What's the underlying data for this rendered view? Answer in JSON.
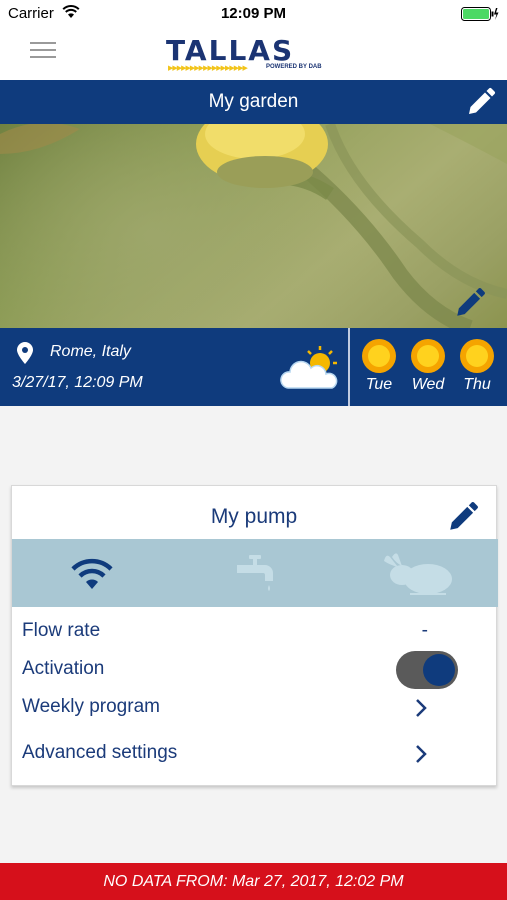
{
  "status_bar": {
    "carrier": "Carrier",
    "time": "12:09 PM"
  },
  "header": {
    "logo_text": "TALLAS",
    "logo_tagline": "POWERED BY DAB"
  },
  "garden": {
    "title": "My garden"
  },
  "weather": {
    "location": "Rome, Italy",
    "datetime": "3/27/17, 12:09 PM",
    "current_icon": "partly-cloudy-icon",
    "forecast": [
      {
        "day": "Tue",
        "icon": "sun-icon"
      },
      {
        "day": "Wed",
        "icon": "sun-icon"
      },
      {
        "day": "Thu",
        "icon": "sun-icon"
      }
    ]
  },
  "pump": {
    "title": "My pump",
    "status_icons": [
      "wifi-icon",
      "faucet-icon",
      "rabbit-icon"
    ],
    "rows": {
      "flow_rate": {
        "label": "Flow rate",
        "value": "-"
      },
      "activation": {
        "label": "Activation",
        "on": true
      },
      "weekly_program": {
        "label": "Weekly program"
      },
      "advanced_settings": {
        "label": "Advanced settings"
      }
    }
  },
  "alert": {
    "text": "NO DATA FROM: Mar 27, 2017, 12:02 PM"
  },
  "colors": {
    "primary": "#0f3b7d",
    "alert": "#d6101b",
    "icon_strip": "#a9c7d3",
    "sun": "#f5b800"
  }
}
